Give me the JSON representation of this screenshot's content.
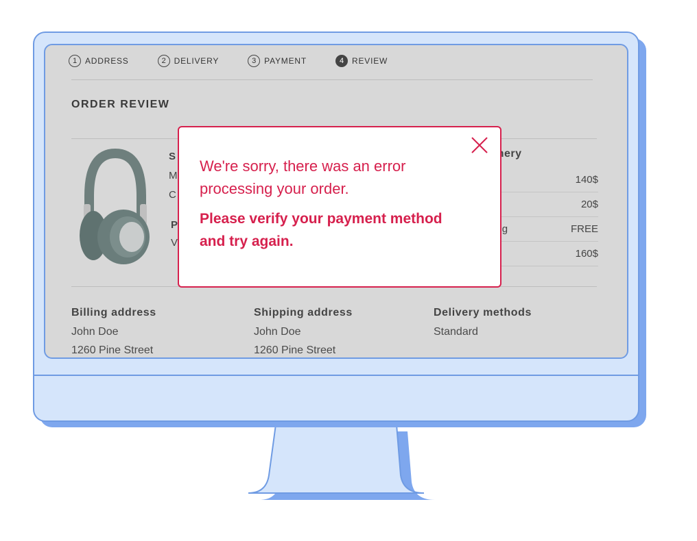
{
  "checkout": {
    "steps": [
      {
        "num": "1",
        "label": "ADDRESS",
        "active": false
      },
      {
        "num": "2",
        "label": "DELIVERY",
        "active": false
      },
      {
        "num": "3",
        "label": "PAYMENT",
        "active": false
      },
      {
        "num": "4",
        "label": "REVIEW",
        "active": true
      }
    ],
    "page_title": "ORDER REVIEW",
    "product_partial": {
      "line1": "S",
      "line2": "M",
      "line3": "C",
      "line4": "P",
      "line5": "V"
    },
    "summary": {
      "title_partial": "nmery",
      "rows": [
        {
          "label": "",
          "value": "140$"
        },
        {
          "label": "",
          "value": "20$"
        },
        {
          "label": "ipping",
          "value": "FREE"
        },
        {
          "label": "",
          "value": "160$"
        }
      ]
    },
    "billing": {
      "title": "Billing address",
      "name": "John Doe",
      "street": "1260 Pine Street"
    },
    "shipping": {
      "title": "Shipping address",
      "name": "John Doe",
      "street": "1260 Pine Street"
    },
    "delivery": {
      "title": "Delivery methods",
      "method": "Standard"
    }
  },
  "error_modal": {
    "message": "We're sorry, there was an error processing your order.",
    "instruction": "Please verify your payment method and try again.",
    "accent_color": "#d6204d"
  },
  "colors": {
    "monitor_fill": "#d5e5fb",
    "monitor_stroke": "#6f9be3",
    "screen_bg": "#d8d8d8"
  }
}
